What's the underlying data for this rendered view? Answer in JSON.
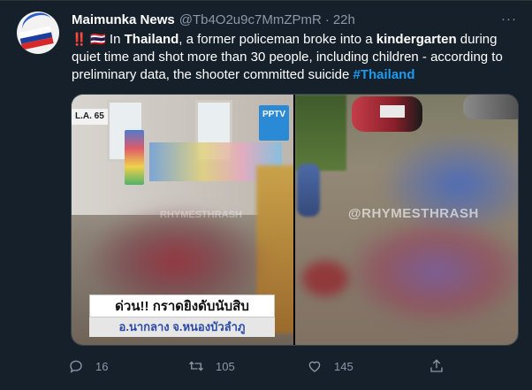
{
  "tweet": {
    "display_name": "Maimunka News",
    "handle": "@Tb4O2u9c7MmZPmR",
    "separator": "·",
    "time": "22h",
    "more_label": "···",
    "emoji_prefix": "‼️ 🇹🇭",
    "text_parts": {
      "p1": " In ",
      "b1": "Thailand",
      "p2": ", a former policeman broke into a ",
      "b2": "kindergarten",
      "p3": " during quiet time and shot more than 30 people, including children - according to preliminary data, the shooter committed suicide ",
      "hashtag": "#Thailand"
    }
  },
  "media": {
    "left_image": {
      "corner_tag": "L.A. 65",
      "channel_logo": "PPTV",
      "watermark": "RHYMESTHRASH",
      "caption_line1": "ด่วน!! กราดยิงดับนับสิบ",
      "caption_line2": "อ.นากลาง จ.หนองบัวลำภู"
    },
    "right_image": {
      "watermark": "@RHYMESTHRASH"
    }
  },
  "actions": {
    "reply": {
      "icon": "reply-icon",
      "count": "16"
    },
    "retweet": {
      "icon": "retweet-icon",
      "count": "105"
    },
    "like": {
      "icon": "heart-icon",
      "count": "145"
    },
    "share": {
      "icon": "share-icon"
    }
  },
  "colors": {
    "background": "#15202b",
    "text_primary": "#ffffff",
    "text_secondary": "#8b98a5",
    "hashtag": "#1d9bf0"
  }
}
